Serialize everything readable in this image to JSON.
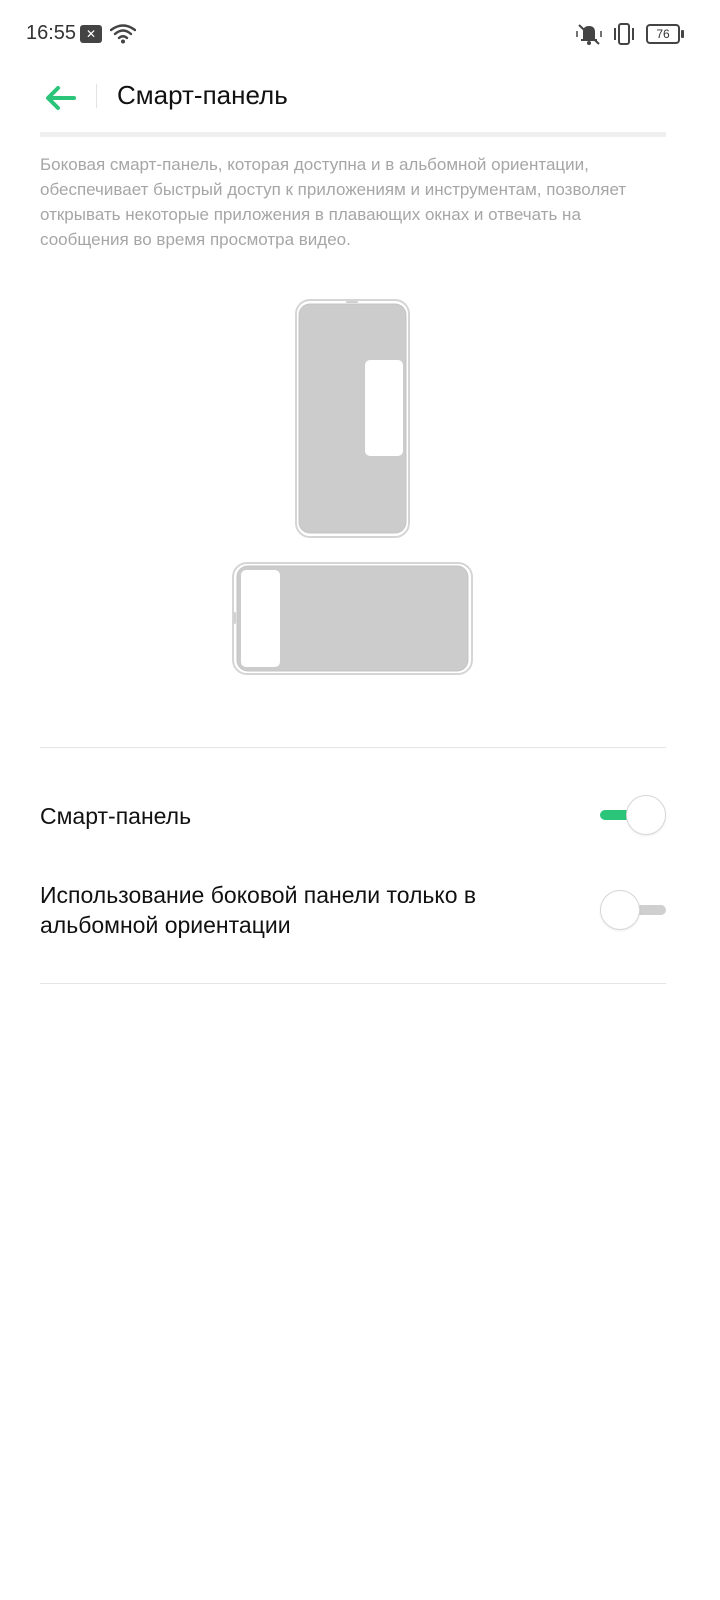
{
  "status_bar": {
    "time": "16:55",
    "battery_level": "76",
    "icons": [
      "notification-x-icon",
      "wifi-icon",
      "mute-icon",
      "vibrate-icon",
      "battery-icon"
    ]
  },
  "header": {
    "title": "Смарт-панель",
    "back_icon": "back-arrow-icon"
  },
  "description": "Боковая смарт-панель, которая доступна и в альбомной ориентации, обеспечивает быстрый доступ к приложениям и инструментам, позволяет открывать некоторые приложения в плавающих окнах и отвечать на сообщения во время просмотра видео.",
  "settings": [
    {
      "label": "Смарт-панель",
      "enabled": true
    },
    {
      "label": "Использование боковой панели только в альбомной ориентации",
      "enabled": false
    }
  ],
  "colors": {
    "accent": "#2bc57a",
    "description_text": "#a6a6a6",
    "illustration_fill": "#cccccc"
  }
}
